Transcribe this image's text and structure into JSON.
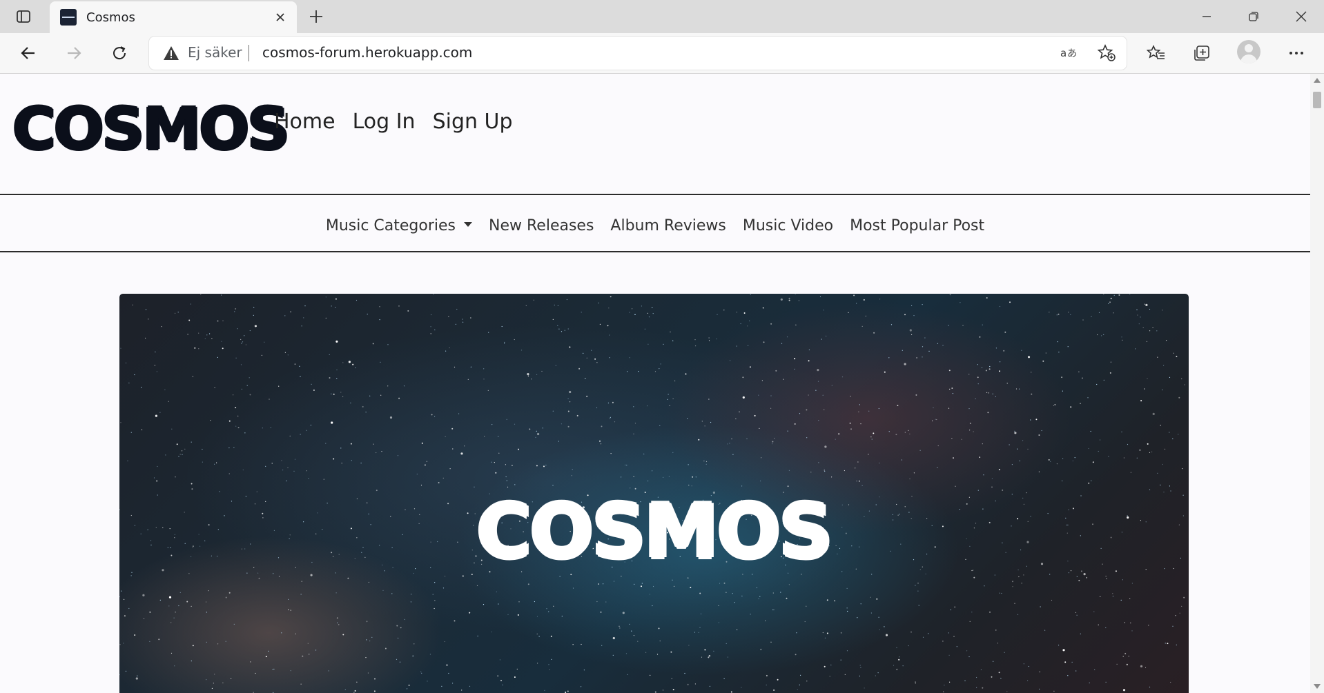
{
  "browser": {
    "tab_title": "Cosmos",
    "security_label": "Ej säker",
    "url": "cosmos-forum.herokuapp.com"
  },
  "site": {
    "logo": "COSMOS",
    "top_nav": [
      "Home",
      "Log In",
      "Sign Up"
    ],
    "category_nav": [
      "Music Categories",
      "New Releases",
      "Album Reviews",
      "Music Video",
      "Most Popular Post"
    ],
    "hero_title": "COSMOS"
  },
  "icons": [
    "tab-actions-icon",
    "close-icon",
    "plus-icon",
    "minimize-icon",
    "restore-icon",
    "back-arrow-icon",
    "forward-arrow-icon",
    "refresh-icon",
    "warning-icon",
    "translate-icon",
    "add-favorite-icon",
    "favorites-icon",
    "collections-icon",
    "profile-avatar",
    "more-icon"
  ]
}
